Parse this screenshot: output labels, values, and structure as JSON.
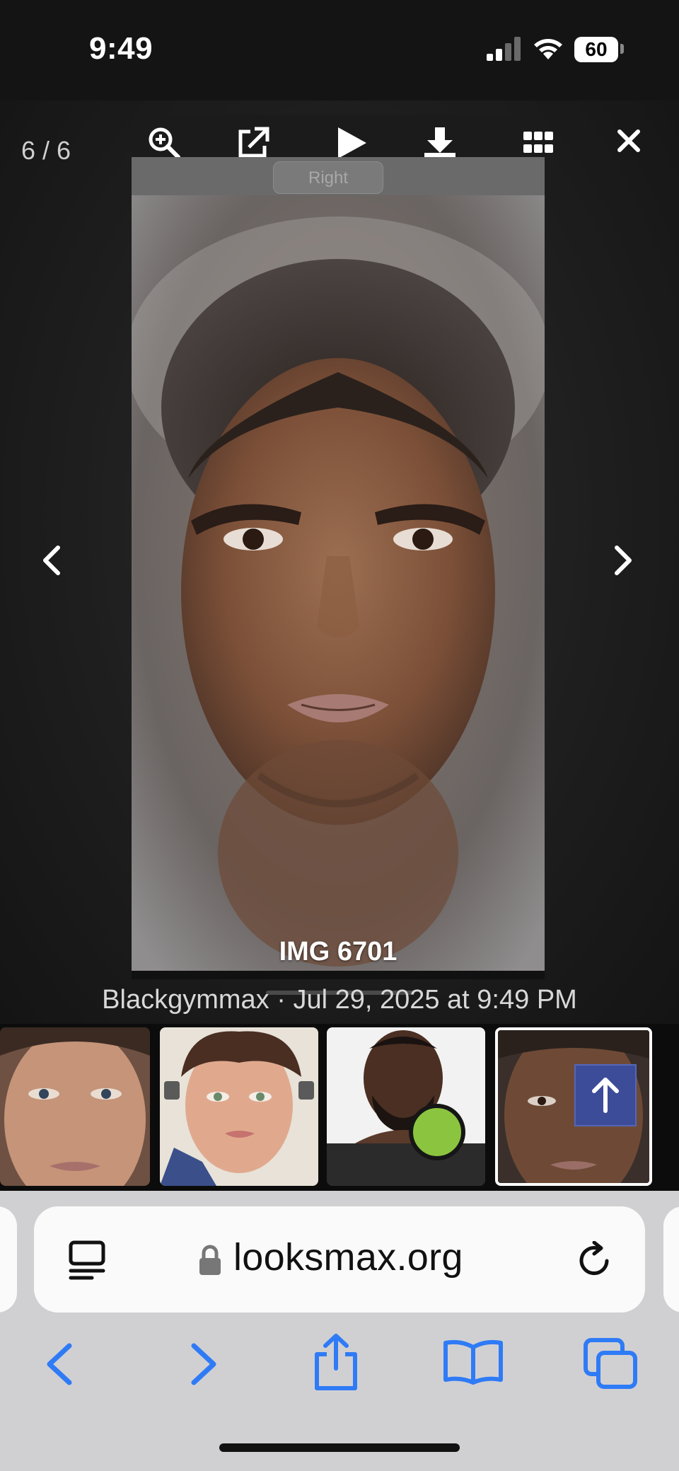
{
  "status_bar": {
    "time": "9:49",
    "battery": "60",
    "signal_icon": "cellular-signal-icon",
    "wifi_icon": "wifi-icon"
  },
  "viewer": {
    "counter": "6 / 6",
    "toolbar": {
      "icons": [
        "zoom-in-icon",
        "open-external-icon",
        "play-icon",
        "download-icon",
        "grid-icon"
      ],
      "close_icon": "close-icon"
    },
    "image_tab_label": "Right",
    "image_caption": "IMG 6701",
    "meta": "Blackgymmax · Jul 29, 2025 at 9:49 PM",
    "nav": {
      "prev_icon": "chevron-left-icon",
      "next_icon": "chevron-right-icon"
    }
  },
  "thumbnails": [
    {
      "name": "thumb-1"
    },
    {
      "name": "thumb-2"
    },
    {
      "name": "thumb-3"
    },
    {
      "name": "thumb-4",
      "selected": true
    }
  ],
  "scroll_top_icon": "arrow-up-icon",
  "browser": {
    "url": "looksmax.org",
    "icons": [
      "reader-icon",
      "lock-icon",
      "reload-icon",
      "back-icon",
      "forward-icon",
      "share-icon",
      "bookmarks-icon",
      "tabs-icon"
    ],
    "accent": "#2f7bf6"
  }
}
